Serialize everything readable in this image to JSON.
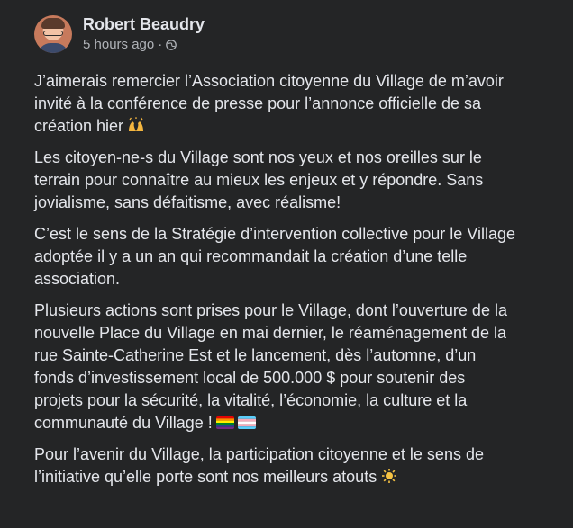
{
  "post": {
    "author": "Robert Beaudry",
    "timestamp": "5 hours ago",
    "separator": "·",
    "privacy_icon": "globe-icon",
    "paragraphs": [
      {
        "text": "J’aimerais remercier l’Association citoyenne du Village de m’avoir\ninvité à la conférence de presse pour l’annonce officielle de sa\ncréation hier",
        "emoji": "raising-hands-emoji"
      },
      {
        "text": "Les citoyen-ne-s du Village sont nos yeux et nos oreilles sur le\nterrain pour connaître au mieux les enjeux et y répondre. Sans\njovialisme, sans défaitisme, avec réalisme!"
      },
      {
        "text": "C’est le sens de la Stratégie d’intervention collective pour le Village\nadoptée il y a un an qui recommandait la création d’une telle\nassociation."
      },
      {
        "text": "Plusieurs actions sont prises pour le Village, dont l’ouverture de la\nnouvelle Place du Village en mai dernier, le réaménagement de la\nrue Sainte-Catherine Est et le lancement, dès l’automne, d’un\nfonds d’investissement local de 500.000 $ pour soutenir des\nprojets pour la sécurité, la vitalité, l’économie, la culture et la\ncommunauté du Village !",
        "emoji": "rainbow-flag-and-transgender-flag-emoji"
      },
      {
        "text": "Pour l’avenir du Village, la participation citoyenne et le sens de\nl’initiative qu’elle porte sont nos meilleurs atouts",
        "emoji": "sparkle-sun-emoji"
      }
    ]
  },
  "colors": {
    "background": "#242526",
    "primary_text": "#e4e6eb",
    "secondary_text": "#b0b3b8"
  }
}
